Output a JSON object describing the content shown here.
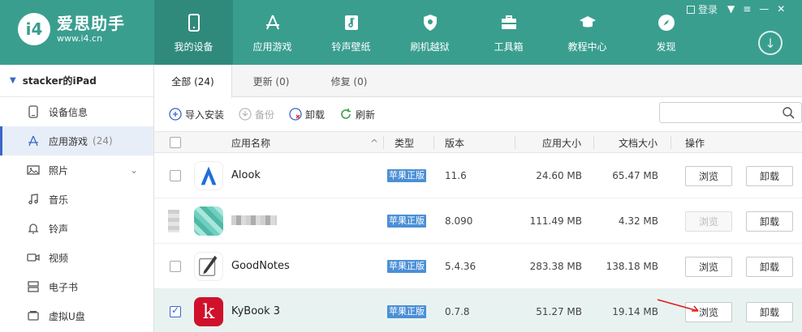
{
  "app": {
    "logo_mark": "i4",
    "logo_title": "爱思助手",
    "logo_url": "www.i4.cn",
    "login_label": "登录"
  },
  "nav": [
    {
      "label": "我的设备",
      "icon": "phone-icon",
      "active": true
    },
    {
      "label": "应用游戏",
      "icon": "app-store-icon",
      "active": false
    },
    {
      "label": "铃声壁纸",
      "icon": "music-wallpaper-icon",
      "active": false
    },
    {
      "label": "刷机越狱",
      "icon": "shield-icon",
      "active": false
    },
    {
      "label": "工具箱",
      "icon": "toolbox-icon",
      "active": false
    },
    {
      "label": "教程中心",
      "icon": "graduation-cap-icon",
      "active": false
    },
    {
      "label": "发现",
      "icon": "compass-icon",
      "active": false
    }
  ],
  "sidebar": {
    "device_name": "stacker的iPad",
    "items": [
      {
        "label": "设备信息",
        "icon": "device-info-icon"
      },
      {
        "label": "应用游戏",
        "icon": "app-icon",
        "count": "(24)",
        "active": true
      },
      {
        "label": "照片",
        "icon": "photo-icon",
        "expandable": true
      },
      {
        "label": "音乐",
        "icon": "music-icon"
      },
      {
        "label": "铃声",
        "icon": "bell-icon"
      },
      {
        "label": "视频",
        "icon": "video-icon"
      },
      {
        "label": "电子书",
        "icon": "ebook-icon"
      },
      {
        "label": "虚拟U盘",
        "icon": "usb-drive-icon"
      }
    ]
  },
  "tabs": [
    {
      "label": "全部 (24)",
      "active": true
    },
    {
      "label": "更新 (0)",
      "active": false
    },
    {
      "label": "修复 (0)",
      "active": false
    }
  ],
  "toolbar": {
    "import_label": "导入安装",
    "backup_label": "备份",
    "uninstall_label": "卸载",
    "refresh_label": "刷新",
    "search_placeholder": ""
  },
  "table": {
    "headers": {
      "name": "应用名称",
      "type": "类型",
      "version": "版本",
      "app_size": "应用大小",
      "doc_size": "文档大小",
      "actions": "操作"
    },
    "browse_label": "浏览",
    "uninstall_label": "卸载",
    "rows": [
      {
        "name": "Alook",
        "type": "苹果正版",
        "version": "11.6",
        "app_size": "24.60 MB",
        "doc_size": "65.47 MB",
        "checked": false,
        "browse_enabled": true
      },
      {
        "name": "",
        "type": "苹果正版",
        "version": "8.090",
        "app_size": "111.49 MB",
        "doc_size": "4.32 MB",
        "checked": false,
        "browse_enabled": false
      },
      {
        "name": "GoodNotes",
        "type": "苹果正版",
        "version": "5.4.36",
        "app_size": "283.38 MB",
        "doc_size": "138.18 MB",
        "checked": false,
        "browse_enabled": true
      },
      {
        "name": "KyBook 3",
        "type": "苹果正版",
        "version": "0.7.8",
        "app_size": "51.27 MB",
        "doc_size": "19.14 MB",
        "checked": true,
        "browse_enabled": true
      }
    ]
  },
  "colors": {
    "header_bg": "#3a9e8f",
    "accent_blue": "#3a67c8",
    "badge_blue": "#4a8fd6",
    "kybook_red": "#d0112b"
  }
}
